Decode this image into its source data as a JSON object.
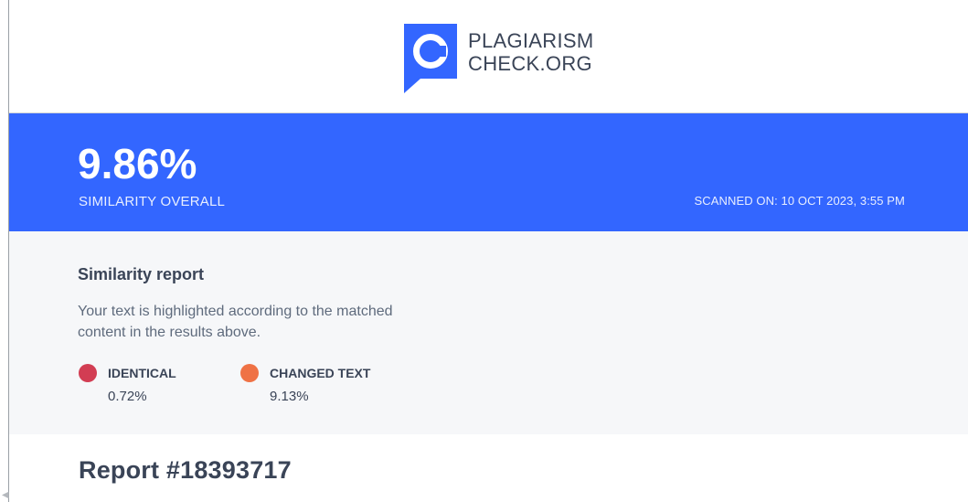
{
  "header": {
    "logo_line1": "PLAGIARISM",
    "logo_line2": "CHECK.ORG",
    "logo_mark_letter": "C",
    "brand_color": "#3366ff"
  },
  "summary": {
    "percentage": "9.86%",
    "label": "SIMILARITY OVERALL",
    "scanned_on": "SCANNED ON: 10 OCT 2023, 3:55 PM"
  },
  "similarity_report": {
    "title": "Similarity report",
    "description": "Your text is highlighted according to the matched content in the results above.",
    "legend": [
      {
        "label": "IDENTICAL",
        "value": "0.72%",
        "color": "#d23d53"
      },
      {
        "label": "CHANGED TEXT",
        "value": "9.13%",
        "color": "#ef7245"
      }
    ]
  },
  "report": {
    "number": "Report #18393717"
  }
}
